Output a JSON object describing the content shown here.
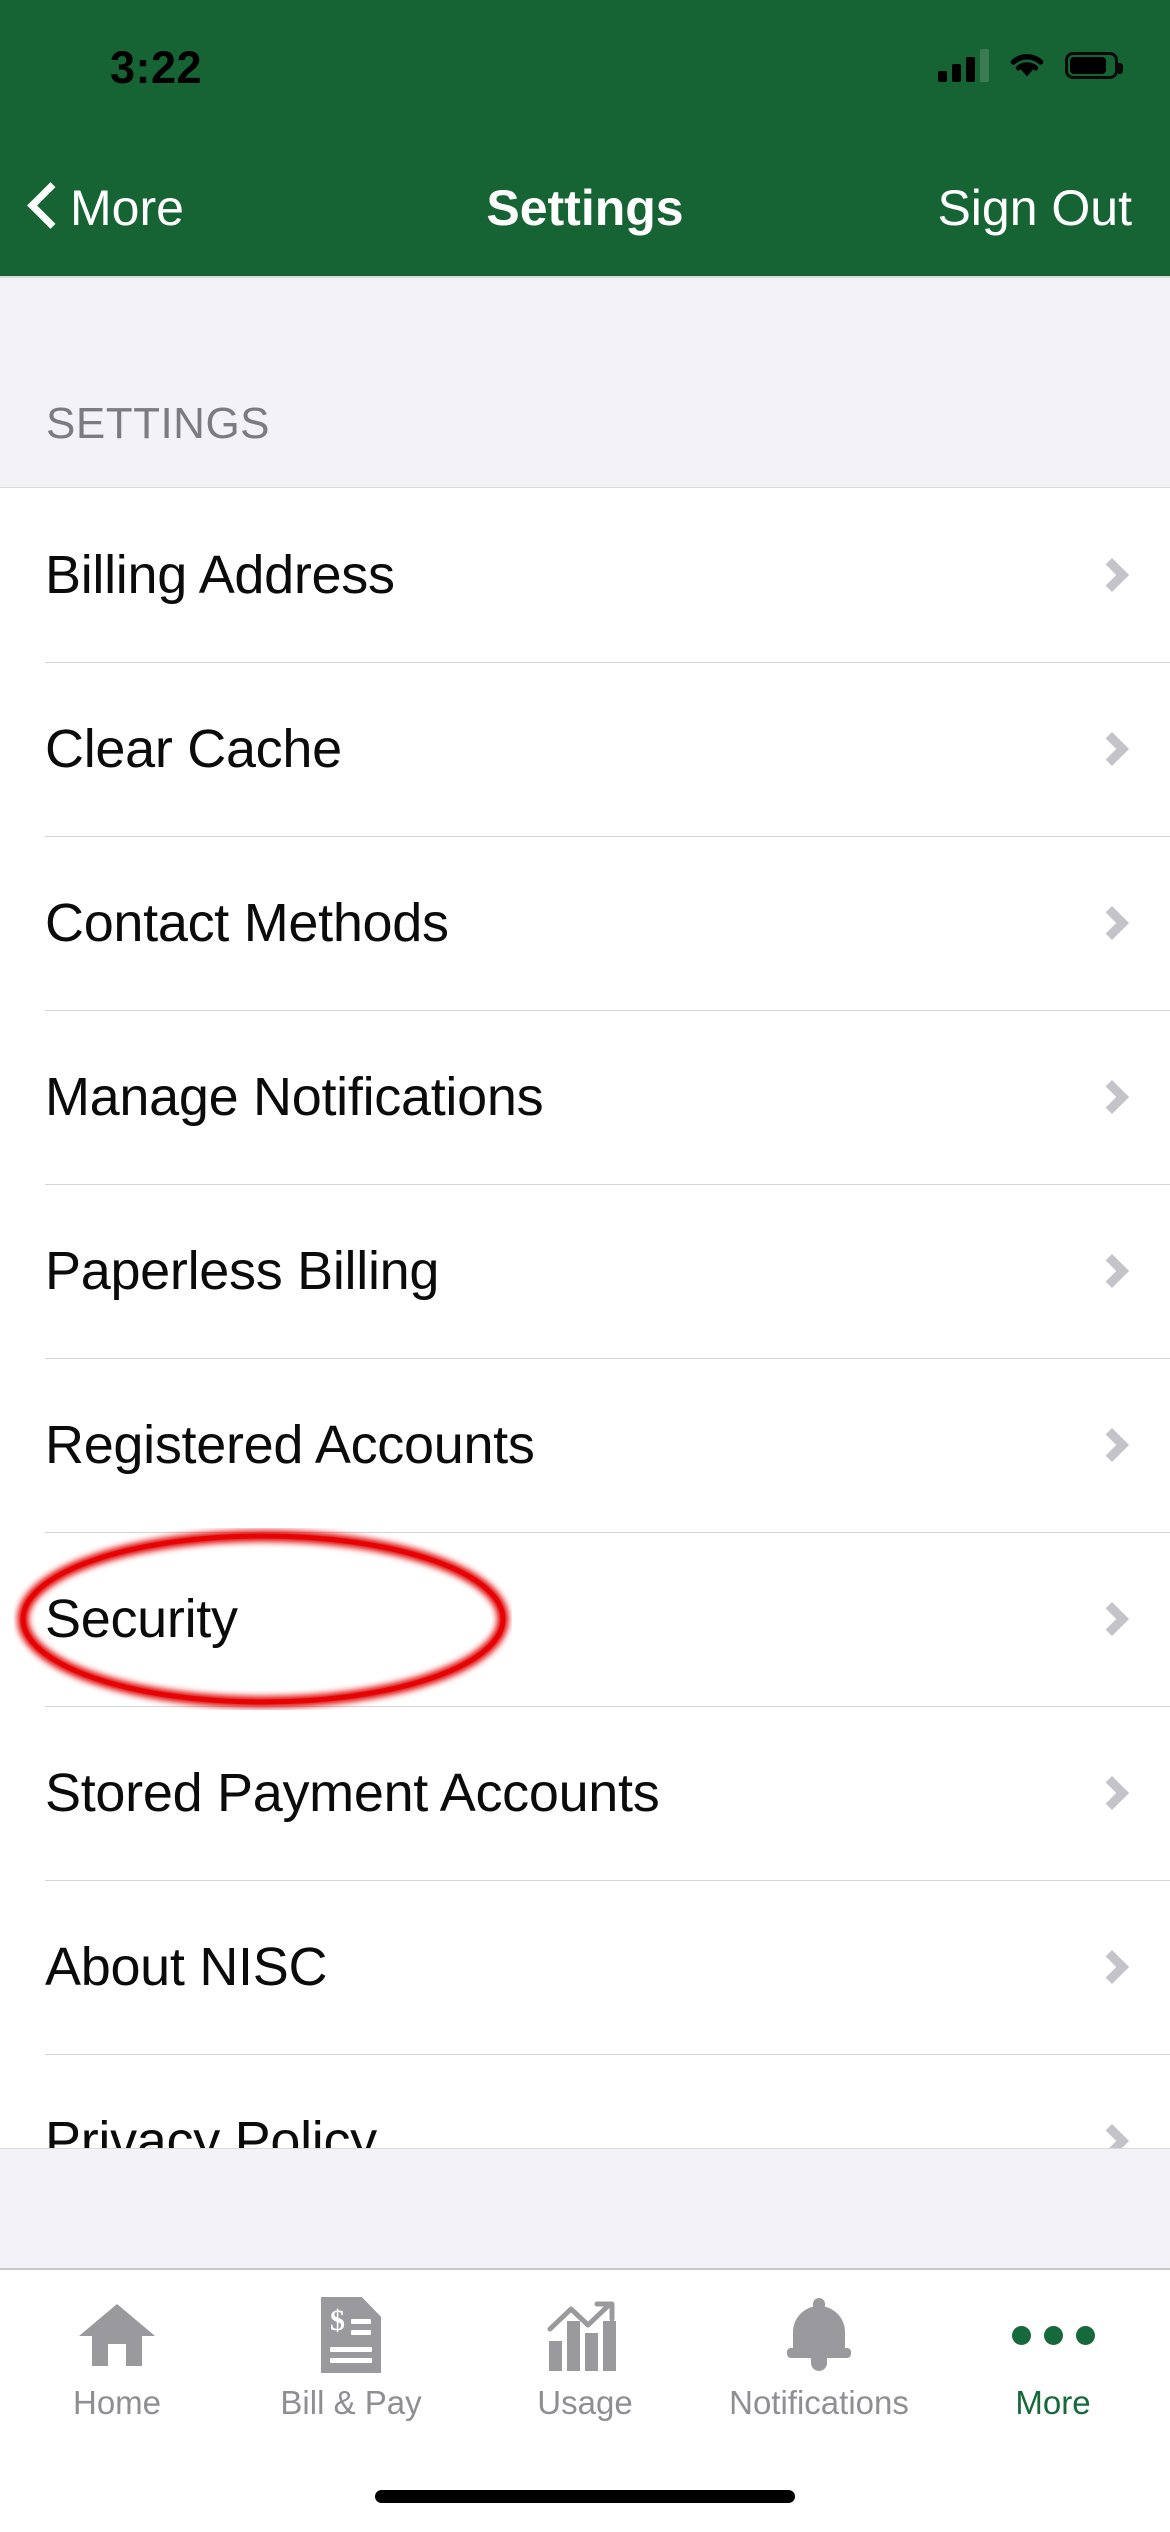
{
  "status_bar": {
    "time": "3:22",
    "cellular_icon": "cellular-signal-icon",
    "wifi_icon": "wifi-icon",
    "battery_icon": "battery-icon",
    "signal_bars_filled": 3,
    "signal_bars_total": 4
  },
  "nav_bar": {
    "back_label": "More",
    "back_icon": "chevron-left-icon",
    "title": "Settings",
    "sign_out_label": "Sign Out",
    "background_color": "#166334"
  },
  "section": {
    "header": "SETTINGS"
  },
  "list": {
    "chevron_icon": "chevron-right-icon",
    "items": [
      {
        "label": "Billing Address"
      },
      {
        "label": "Clear Cache"
      },
      {
        "label": "Contact Methods"
      },
      {
        "label": "Manage Notifications"
      },
      {
        "label": "Paperless Billing"
      },
      {
        "label": "Registered Accounts"
      },
      {
        "label": "Security"
      },
      {
        "label": "Stored Payment Accounts"
      },
      {
        "label": "About NISC"
      },
      {
        "label": "Privacy Policy"
      }
    ]
  },
  "annotation": {
    "shape": "ellipse",
    "color": "#e00000",
    "target_label": "Security"
  },
  "tab_bar": {
    "active_color": "#16693a",
    "inactive_color": "#8e8e93",
    "tabs": [
      {
        "label": "Home",
        "icon": "home-icon",
        "active": false
      },
      {
        "label": "Bill & Pay",
        "icon": "bill-document-icon",
        "active": false
      },
      {
        "label": "Usage",
        "icon": "bar-chart-icon",
        "active": false
      },
      {
        "label": "Notifications",
        "icon": "bell-icon",
        "active": false
      },
      {
        "label": "More",
        "icon": "ellipsis-icon",
        "active": true
      }
    ]
  }
}
